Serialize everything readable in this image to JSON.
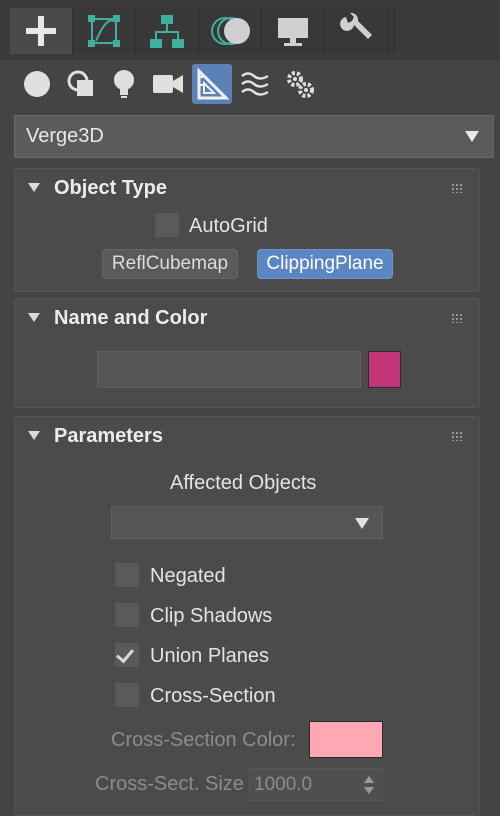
{
  "tabs": [
    {
      "icon": "plus-create-icon"
    },
    {
      "icon": "modify-icon"
    },
    {
      "icon": "hierarchy-icon"
    },
    {
      "icon": "motion-icon"
    },
    {
      "icon": "display-icon"
    },
    {
      "icon": "utilities-wrench-icon"
    }
  ],
  "subcategories": [
    {
      "icon": "geometry-sphere-icon"
    },
    {
      "icon": "shapes-icon"
    },
    {
      "icon": "lights-bulb-icon"
    },
    {
      "icon": "camera-icon"
    },
    {
      "icon": "helpers-triangle-ruler-icon",
      "active": true
    },
    {
      "icon": "space-warps-icon"
    },
    {
      "icon": "systems-gears-icon"
    }
  ],
  "category": {
    "value": "Verge3D"
  },
  "object_type": {
    "title": "Object Type",
    "autogrid_label": "AutoGrid",
    "autogrid_checked": false,
    "buttons": [
      "ReflCubemap",
      "ClippingPlane"
    ],
    "active_button": "ClippingPlane"
  },
  "name_color": {
    "title": "Name and Color",
    "name_value": "",
    "color": "#c5357a"
  },
  "parameters": {
    "title": "Parameters",
    "affected_label": "Affected Objects",
    "affected_value": "",
    "negated_label": "Negated",
    "negated_checked": false,
    "clip_shadows_label": "Clip Shadows",
    "clip_shadows_checked": false,
    "union_label": "Union Planes",
    "union_checked": true,
    "cross_section_label": "Cross-Section",
    "cross_section_checked": false,
    "cross_color_label": "Cross-Section Color:",
    "cross_color": "#ffa7b2",
    "cross_size_label": "Cross-Sect. Size",
    "cross_size_value": "1000.0"
  },
  "colors": {
    "accent": "#5a87c4",
    "panel": "#4b4b4b",
    "background": "#444444"
  }
}
